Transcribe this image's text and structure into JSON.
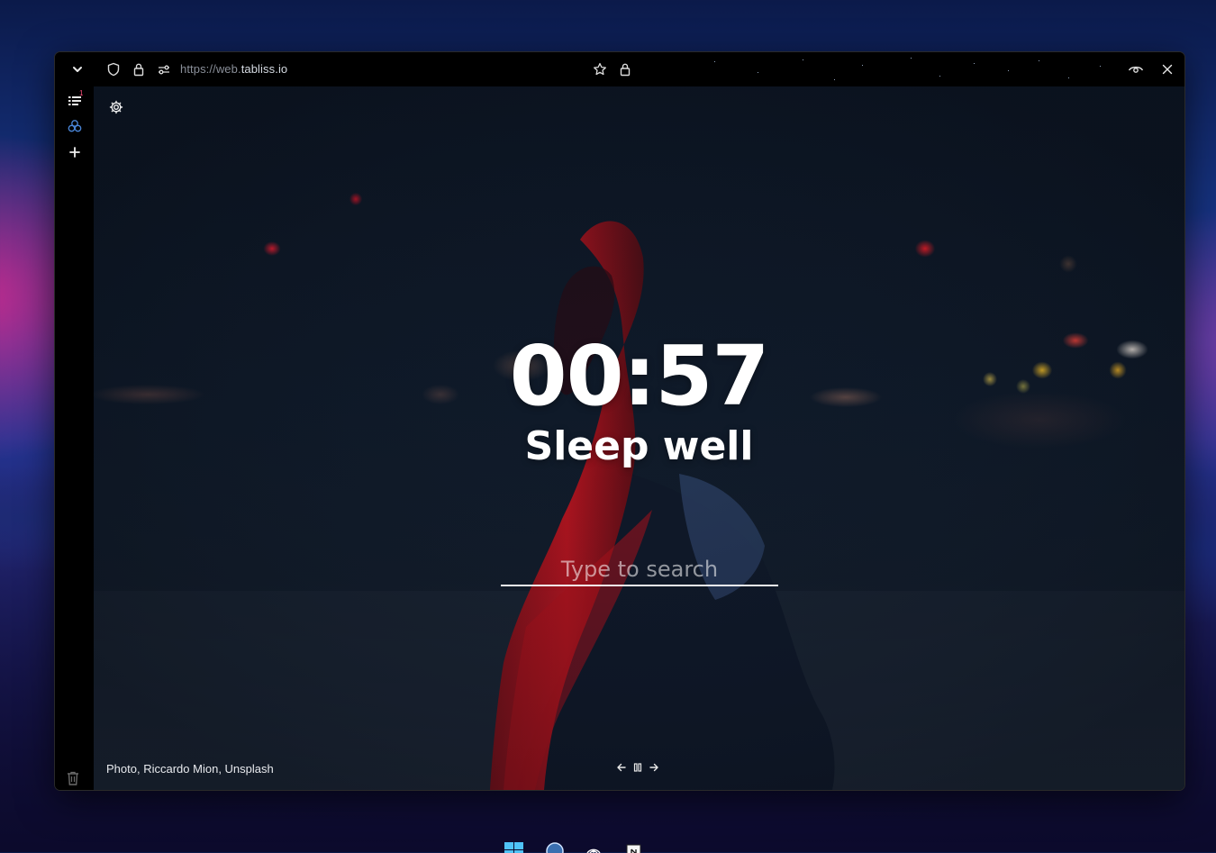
{
  "browser": {
    "url_scheme": "https://web.",
    "url_host": "tabliss.io"
  },
  "sidebar": {
    "panel_badge": "1"
  },
  "newtab": {
    "time": "00:57",
    "greeting": "Sleep well",
    "search_placeholder": "Type to search",
    "credit_photo": "Photo",
    "credit_author": "Riccardo Mion",
    "credit_source": "Unsplash"
  },
  "colors": {
    "toolbar_bg": "#000000",
    "url_host": "#d6dbe3",
    "badge": "#ff4f7b",
    "text": "#ffffff"
  },
  "icons": {
    "toolbar": [
      "chevron-down-icon",
      "shield-icon",
      "lock-icon",
      "site-settings-icon",
      "star-icon",
      "lock-icon",
      "eye-icon",
      "close-icon"
    ],
    "sidebar": [
      "panel-list-icon",
      "workspace-icon",
      "add-icon",
      "trash-icon"
    ],
    "taskbar": [
      "start-icon",
      "browser-icon",
      "broadcast-icon",
      "notion-icon"
    ]
  }
}
